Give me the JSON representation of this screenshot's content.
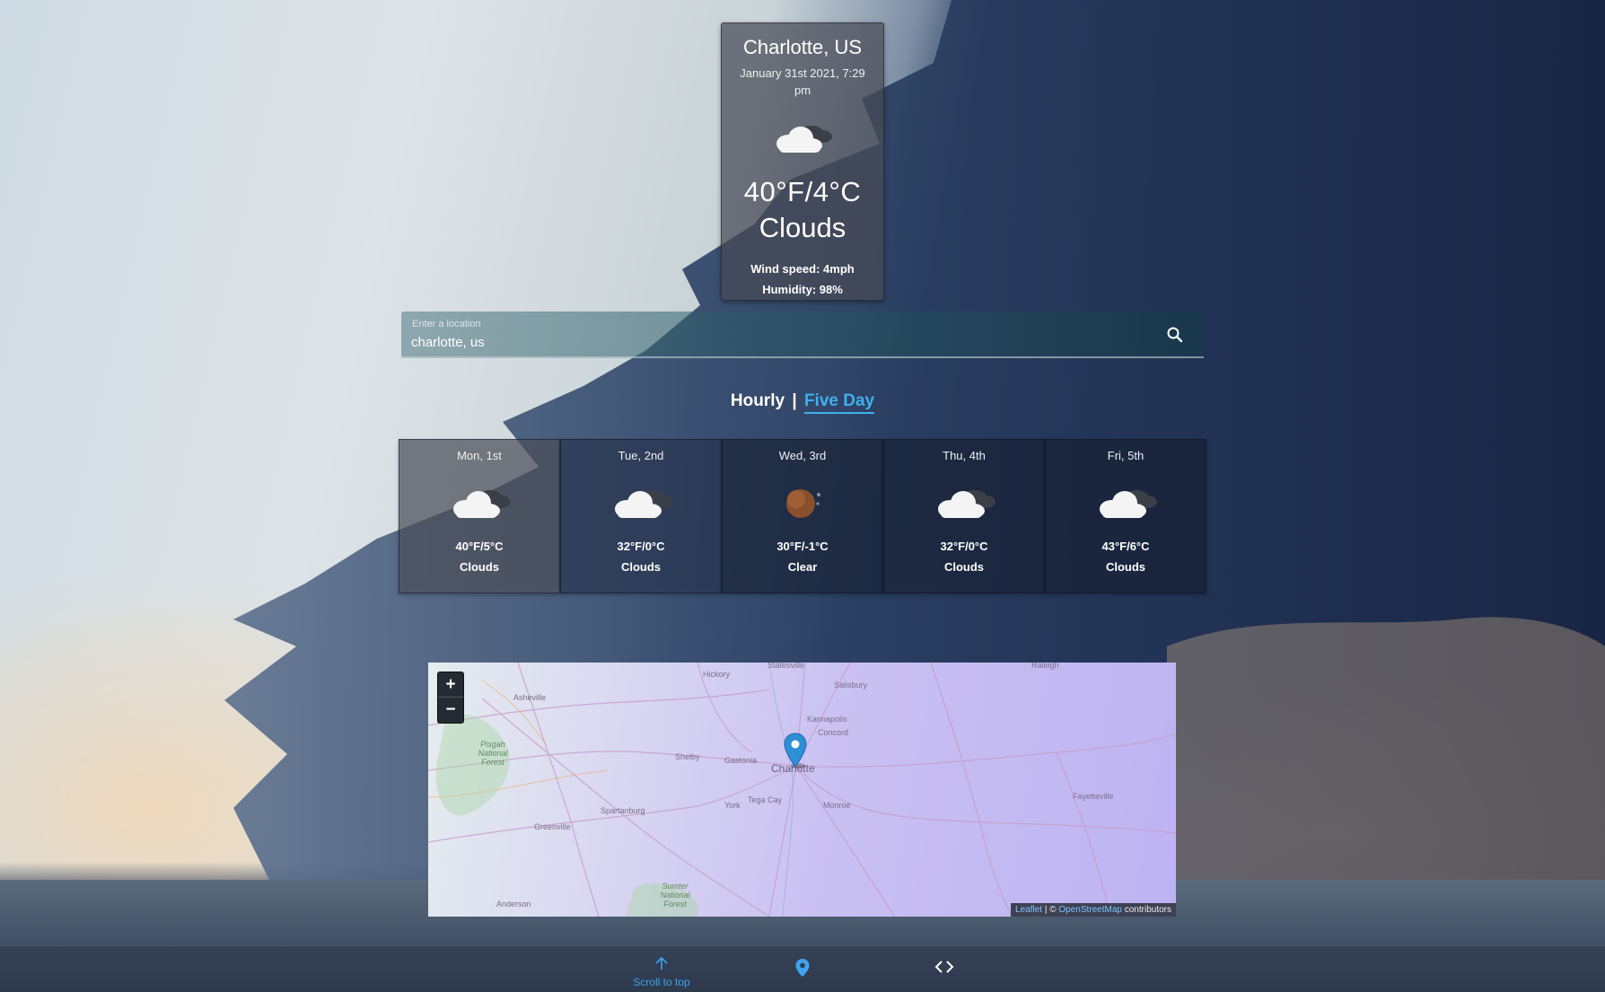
{
  "current": {
    "city": "Charlotte, US",
    "date": "January 31st 2021, 7:29 pm",
    "icon": "clouds-icon",
    "temp": "40°F/4°C",
    "description": "Clouds",
    "wind": "Wind speed: 4mph",
    "humidity": "Humidity: 98%"
  },
  "search": {
    "label": "Enter a location",
    "value": "charlotte, us",
    "icon": "search-icon"
  },
  "tabs": {
    "hourly": "Hourly",
    "separator": "|",
    "five_day": "Five Day",
    "active": "Five Day",
    "active_color": "#3fb0ee"
  },
  "forecast": [
    {
      "day": "Mon, 1st",
      "icon": "clouds-icon",
      "temp": "40°F/5°C",
      "desc": "Clouds"
    },
    {
      "day": "Tue, 2nd",
      "icon": "clouds-icon",
      "temp": "32°F/0°C",
      "desc": "Clouds"
    },
    {
      "day": "Wed, 3rd",
      "icon": "clear-night-icon",
      "temp": "30°F/-1°C",
      "desc": "Clear"
    },
    {
      "day": "Thu, 4th",
      "icon": "clouds-icon",
      "temp": "32°F/0°C",
      "desc": "Clouds"
    },
    {
      "day": "Fri, 5th",
      "icon": "clouds-icon",
      "temp": "43°F/6°C",
      "desc": "Clouds"
    }
  ],
  "map": {
    "zoom_in": "+",
    "zoom_out": "−",
    "labels": {
      "raleigh": "Raleigh",
      "statesville": "Statesville",
      "hickory": "Hickory",
      "salisbury": "Salisbury",
      "asheville": "Asheville",
      "kannapolis": "Kannapolis",
      "concord": "Concord",
      "shelby": "Shelby",
      "gastonia": "Gastonia",
      "charlotte": "Charlotte",
      "pisgah": "Pisgah National Forest",
      "spartanburg": "Spartanburg",
      "tega_cay": "Tega Cay",
      "york": "York",
      "monroe": "Monroe",
      "fayetteville": "Fayetteville",
      "greenville": "Greenville",
      "sumter": "Sumter National Forest",
      "anderson": "Anderson"
    },
    "attribution": {
      "leaflet": "Leaflet",
      "separator": " | © ",
      "osm": "OpenStreetMap",
      "suffix": " contributors"
    }
  },
  "footer": {
    "scroll_top": "Scroll to top",
    "pin_icon": "map-pin-icon",
    "code_icon": "code-icon"
  },
  "colors": {
    "accent": "#3fb0ee",
    "marker": "#2f8fd6"
  }
}
